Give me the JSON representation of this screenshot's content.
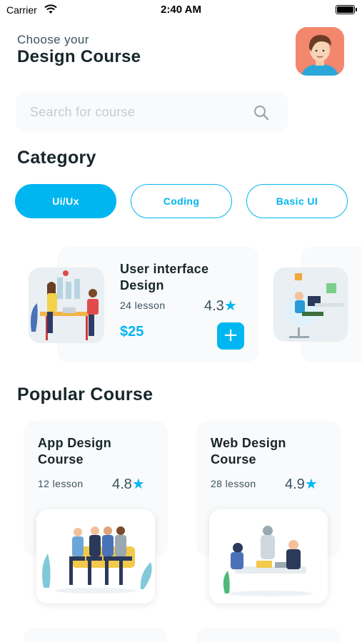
{
  "status_bar": {
    "carrier": "Carrier",
    "time": "2:40 AM"
  },
  "header": {
    "greeting": "Choose your",
    "title": "Design Course"
  },
  "search": {
    "placeholder": "Search for course"
  },
  "category": {
    "heading": "Category",
    "chips": [
      {
        "label": "Ui/Ux",
        "active": true
      },
      {
        "label": "Coding",
        "active": false
      },
      {
        "label": "Basic UI",
        "active": false
      }
    ]
  },
  "featured": {
    "title": "User interface Design",
    "lessons": "24 lesson",
    "rating": "4.3",
    "price": "$25",
    "add_label": "+"
  },
  "popular": {
    "heading": "Popular Course",
    "courses": [
      {
        "title": "App Design Course",
        "lessons": "12 lesson",
        "rating": "4.8"
      },
      {
        "title": "Web Design Course",
        "lessons": "28 lesson",
        "rating": "4.9"
      }
    ]
  },
  "icons": {
    "star": "★",
    "search": "search-icon"
  },
  "colors": {
    "accent": "#00b6f0",
    "text_dark": "#17262a",
    "text_muted": "#3a5160",
    "card_bg": "#f8fafb"
  }
}
